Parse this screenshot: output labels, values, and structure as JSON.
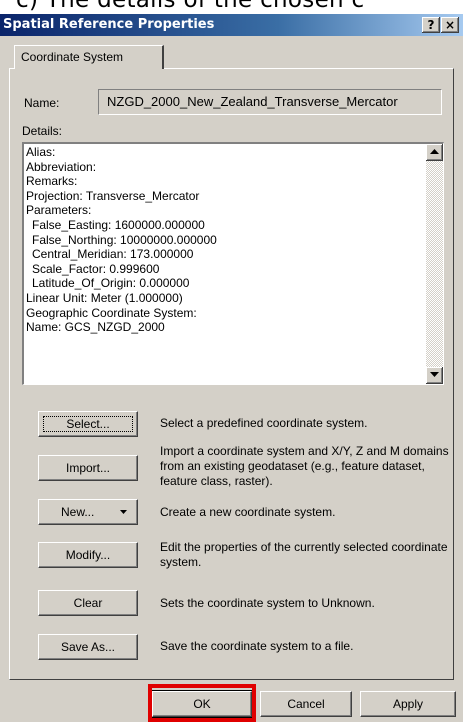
{
  "caption": {
    "text": "c)     The details of the chosen c"
  },
  "window": {
    "title": "Spatial Reference Properties",
    "help_btn": "?",
    "close_btn": "×"
  },
  "tabs": [
    {
      "label": "Coordinate System",
      "selected": true
    }
  ],
  "name": {
    "label": "Name:",
    "value": "NZGD_2000_New_Zealand_Transverse_Mercator"
  },
  "details": {
    "label": "Details:",
    "lines": [
      "Alias:",
      "Abbreviation:",
      "Remarks:",
      "Projection: Transverse_Mercator",
      "Parameters:",
      "  False_Easting: 1600000.000000",
      "  False_Northing: 10000000.000000",
      "  Central_Meridian: 173.000000",
      "  Scale_Factor: 0.999600",
      "  Latitude_Of_Origin: 0.000000",
      "Linear Unit: Meter (1.000000)",
      "Geographic Coordinate System:",
      "Name: GCS_NZGD_2000"
    ]
  },
  "actions": [
    {
      "button": "Select...",
      "description": "Select a predefined coordinate system."
    },
    {
      "button": "Import...",
      "description": "Import a coordinate system and X/Y, Z and M domains from an existing geodataset (e.g., feature dataset, feature class, raster)."
    },
    {
      "button": "New...",
      "description": "Create a new coordinate system."
    },
    {
      "button": "Modify...",
      "description": "Edit the properties of the currently selected coordinate system."
    },
    {
      "button": "Clear",
      "description": "Sets the coordinate system to Unknown."
    },
    {
      "button": "Save As...",
      "description": "Save the coordinate system to a file."
    }
  ],
  "footer": {
    "ok": "OK",
    "cancel": "Cancel",
    "apply": "Apply"
  },
  "colors": {
    "titlebar": "#0a246a",
    "face": "#d4d0c8",
    "highlight": "#e00000"
  }
}
